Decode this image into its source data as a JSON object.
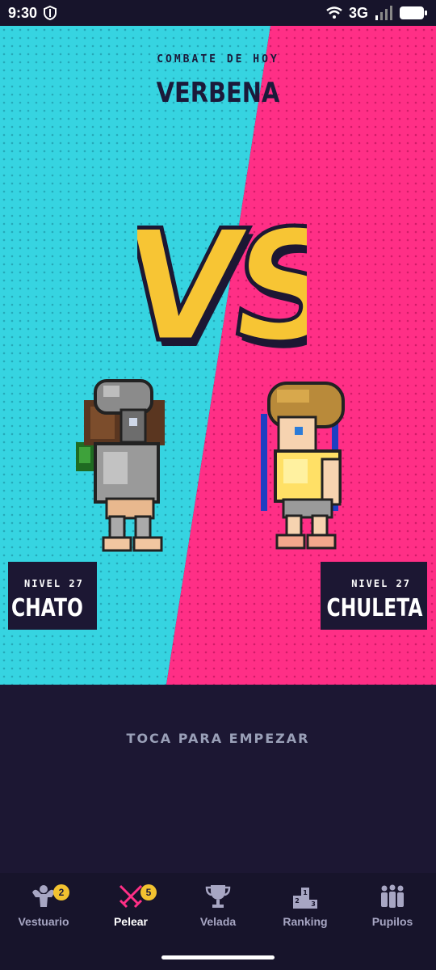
{
  "status_bar": {
    "time": "9:30",
    "network": "3G"
  },
  "fight": {
    "subtitle": "COMBATE DE HOY",
    "title": "VERBENA",
    "vs_label": "VS",
    "left_fighter": {
      "level": "NIVEL 27",
      "name": "CHATO"
    },
    "right_fighter": {
      "level": "NIVEL 27",
      "name": "CHULETA"
    },
    "tap_prompt": "TOCA PARA EMPEZAR"
  },
  "colors": {
    "left_bg": "#36d4e1",
    "right_bg": "#ff2f86",
    "vs_fill": "#f7c534",
    "dark": "#1c1733"
  },
  "nav": {
    "items": [
      {
        "label": "Vestuario",
        "icon": "muscle-icon",
        "badge": "2"
      },
      {
        "label": "Pelear",
        "icon": "crossed-swords-icon",
        "badge": "5",
        "active": true
      },
      {
        "label": "Velada",
        "icon": "trophy-icon"
      },
      {
        "label": "Ranking",
        "icon": "podium-icon"
      },
      {
        "label": "Pupilos",
        "icon": "group-icon"
      }
    ]
  }
}
